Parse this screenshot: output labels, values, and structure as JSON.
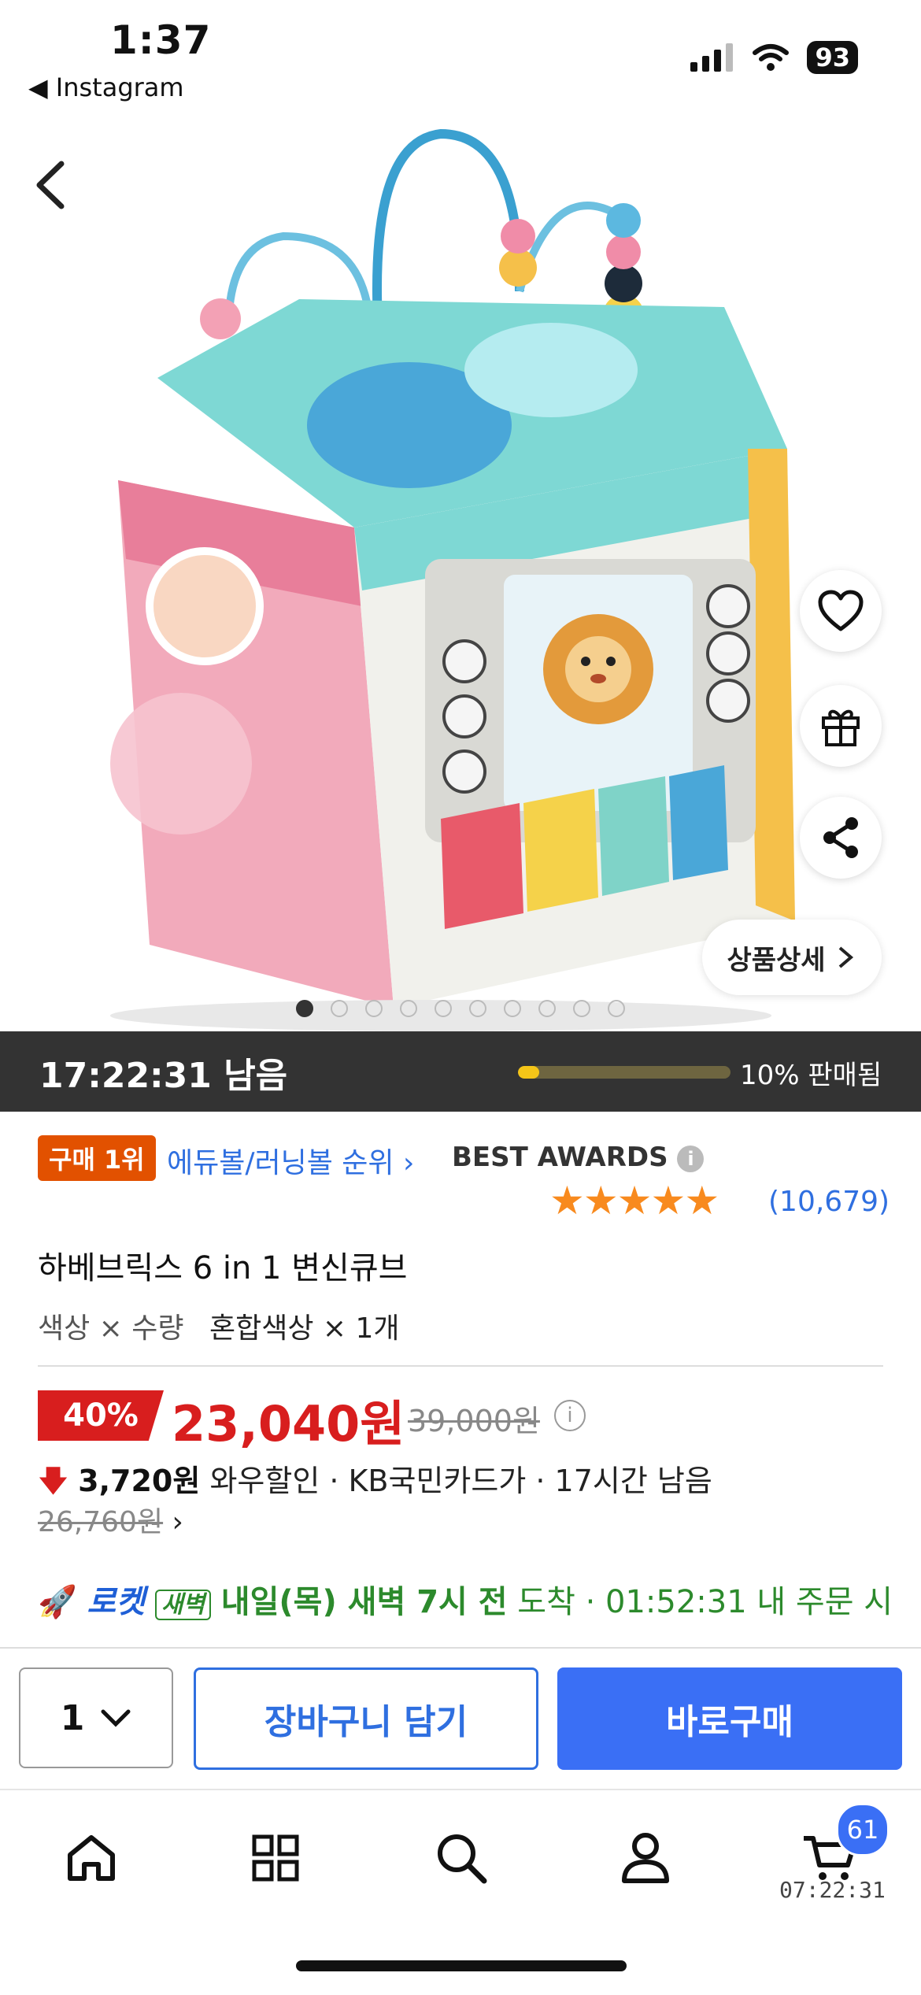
{
  "status": {
    "time": "1:37",
    "back_app": "◀ Instagram",
    "battery": "93"
  },
  "product_nav": {
    "detail_label": "상품상세",
    "image_count": 10,
    "active_image": 1
  },
  "timer": {
    "remaining": "17:22:31 남음",
    "sold_percent": 10,
    "sold_label": "10% 판매됨"
  },
  "product": {
    "rank_badge": "구매 1위",
    "rank_link": "에듀볼/러닝볼 순위",
    "awards": "BEST AWARDS",
    "rating": 5,
    "review_count": "(10,679)",
    "title": "하베브릭스 6 in 1 변신큐브",
    "option_label": "색상 × 수량",
    "option_value": "혼합색상 × 1개",
    "discount": "40%",
    "price": "23,040원",
    "original_price": "39,000원",
    "wow_amount": "3,720원",
    "wow_text": "와우할인 · KB국민카드가 · 17시간 남음",
    "wow_price": "26,760원",
    "rocket_brand": "로켓",
    "rocket_tag": "새벽",
    "delivery_bold": "내일(목) 새벽 7시 전",
    "delivery_text": "도착 · 01:52:31 내 주문 시"
  },
  "actions": {
    "quantity": "1",
    "cart_label": "장바구니 담기",
    "buy_label": "바로구매"
  },
  "tabbar": {
    "cart_count": "61",
    "cart_time": "07:22:31"
  },
  "colors": {
    "accent_blue": "#3a6ff5",
    "price_red": "#d81e1e",
    "rank_orange": "#e25100",
    "rocket_green": "#2c8a2c"
  }
}
